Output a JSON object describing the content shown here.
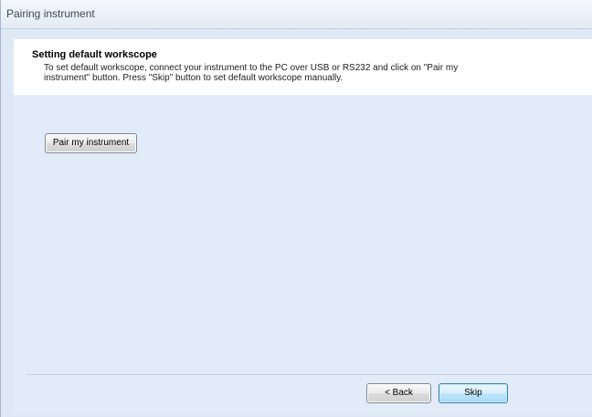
{
  "window": {
    "title": "Pairing instrument"
  },
  "header": {
    "title": "Setting default workscope",
    "description": "To set default workscope, connect your instrument to the PC over USB or RS232 and click on \"Pair my instrument\" button. Press \"Skip\" button to set default workscope manually."
  },
  "body": {
    "pair_button_label": "Pair my instrument"
  },
  "footer": {
    "back_label": "< Back",
    "skip_label": "Skip"
  },
  "colors": {
    "window_background": "#dfe9f6",
    "header_background": "#ffffff",
    "skip_button_accent": "#3c7fb1"
  }
}
